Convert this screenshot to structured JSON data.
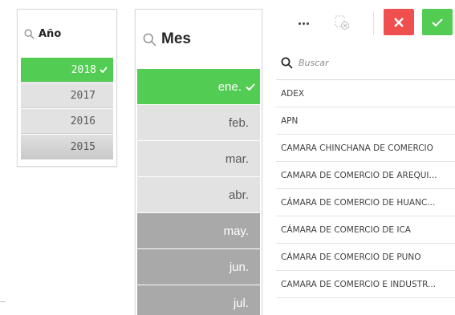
{
  "year_filter": {
    "title": "Año",
    "items": [
      {
        "label": "2018",
        "state": "selected"
      },
      {
        "label": "2017",
        "state": "alternative"
      },
      {
        "label": "2016",
        "state": "alternative"
      },
      {
        "label": "2015",
        "state": "alternative"
      }
    ]
  },
  "month_filter": {
    "title": "Mes",
    "items": [
      {
        "label": "ene.",
        "state": "selected"
      },
      {
        "label": "feb.",
        "state": "alternative"
      },
      {
        "label": "mar.",
        "state": "alternative"
      },
      {
        "label": "abr.",
        "state": "alternative"
      },
      {
        "label": "may.",
        "state": "excluded"
      },
      {
        "label": "jun.",
        "state": "excluded"
      },
      {
        "label": "jul.",
        "state": "excluded"
      }
    ]
  },
  "selection_toolbar": {
    "more_icon": "more-horizontal-icon",
    "clear_icon": "clear-selection-icon",
    "cancel_icon": "close-icon",
    "confirm_icon": "check-icon"
  },
  "company_list": {
    "search_placeholder": "Buscar",
    "items": [
      "ADEX",
      "APN",
      "CAMARA CHINCHANA DE COMERCIO",
      "CAMARA DE COMERCIO DE AREQUI...",
      "CÁMARA DE COMERCIO DE HUANC...",
      "CÁMARA DE COMERCIO DE ICA",
      "CÁMARA DE COMERCIO DE PUNO",
      "CAMARA DE COMERCIO E INDUSTR..."
    ]
  },
  "colors": {
    "selected": "#52cc52",
    "alternative": "#e2e2e2",
    "excluded": "#a9a9a9",
    "cancel": "#ef4f4f"
  }
}
